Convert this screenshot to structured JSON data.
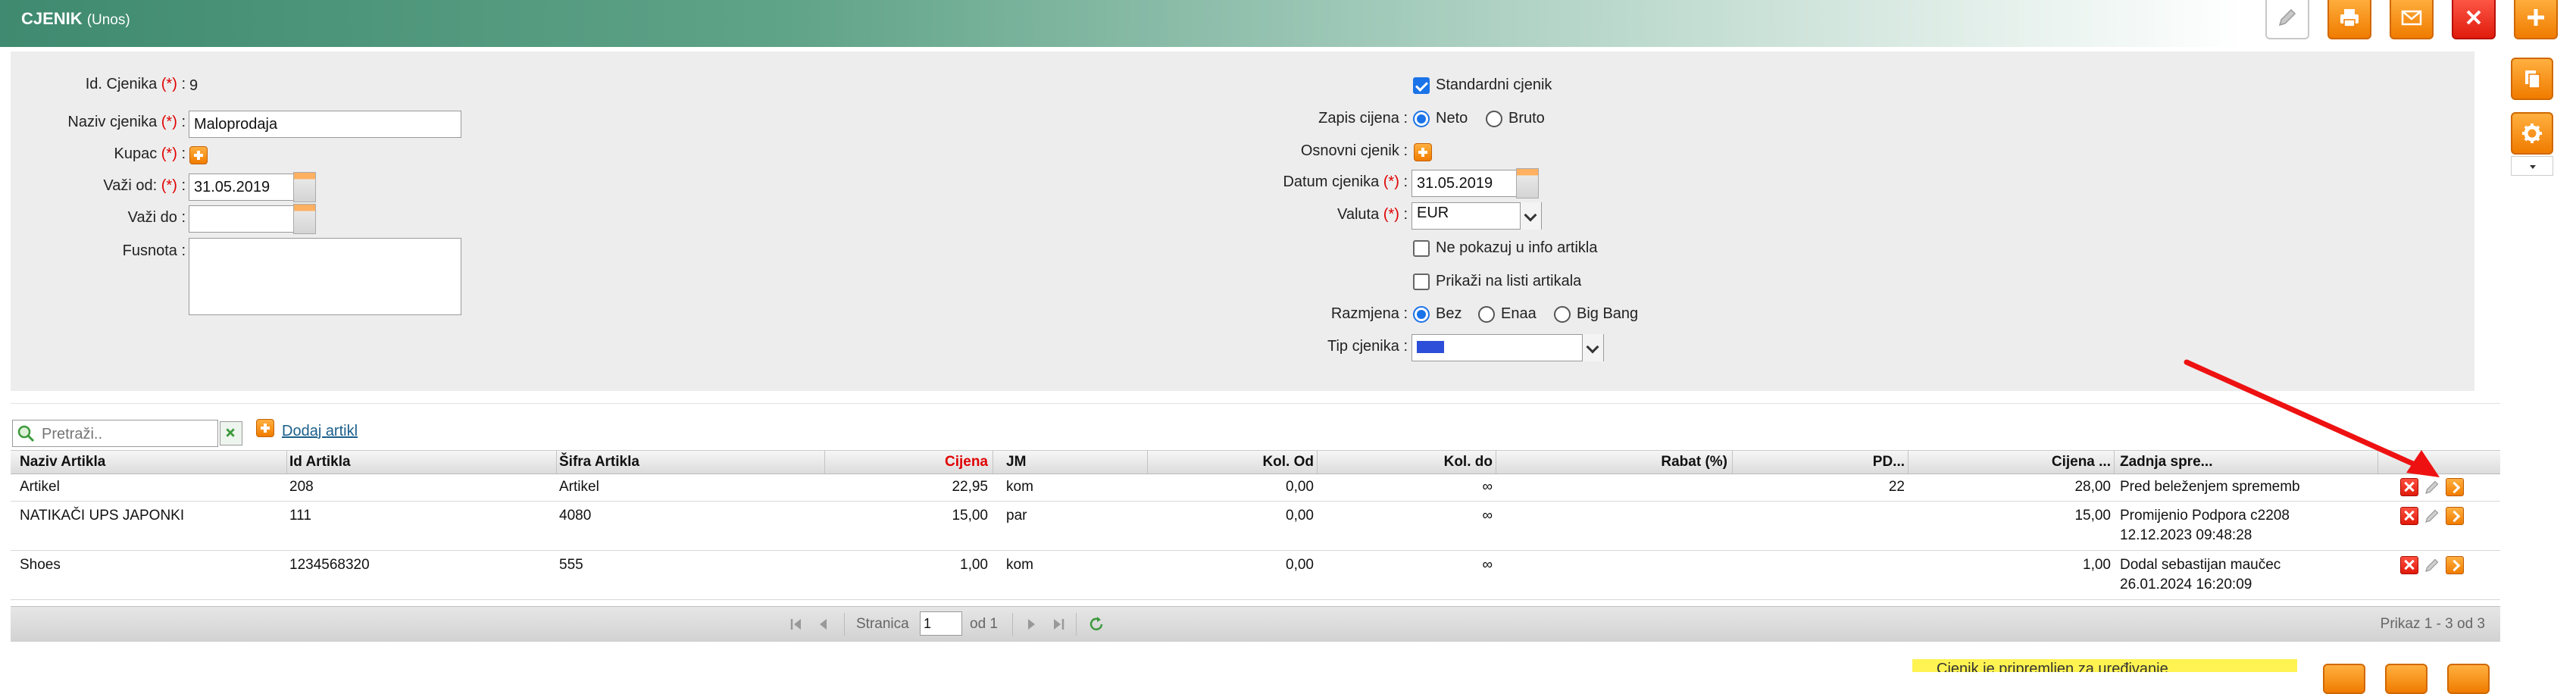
{
  "header": {
    "title": "CJENIK",
    "mode": "(Unos)",
    "toolbar_icons": [
      "pencil-icon",
      "printer-icon",
      "envelope-icon",
      "close-icon",
      "plus-icon"
    ],
    "side_icons": [
      "copy-icon",
      "gear-icon",
      "chevron-down-icon"
    ]
  },
  "form": {
    "id_label": "Id. Cjenika",
    "id_value": "9",
    "naziv_label": "Naziv cjenika",
    "naziv_value": "Maloprodaja",
    "kupac_label": "Kupac",
    "vazi_od_label": "Važi od:",
    "vazi_od_value": "31.05.2019",
    "vazi_do_label": "Važi do",
    "vazi_do_value": "",
    "fusnota_label": "Fusnota",
    "fusnota_value": "",
    "standardni_label": "Standardni cjenik",
    "standardni_checked": true,
    "zapis_label": "Zapis cijena",
    "zapis_options": [
      "Neto",
      "Bruto"
    ],
    "zapis_selected": "Neto",
    "osnovni_label": "Osnovni cjenik",
    "datum_label": "Datum cjenika",
    "datum_value": "31.05.2019",
    "valuta_label": "Valuta",
    "valuta_value": "EUR",
    "ne_pokazuj_label": "Ne pokazuj u info artikla",
    "prikazi_label": "Prikaži na listi artikala",
    "razmjena_label": "Razmjena",
    "razmjena_options": [
      "Bez",
      "Enaa",
      "Big Bang"
    ],
    "razmjena_selected": "Bez",
    "tip_label": "Tip cjenika",
    "required_mark": "(*)",
    "colon": ":"
  },
  "search": {
    "placeholder": "Pretraži..",
    "add_link": "Dodaj artikl"
  },
  "table": {
    "columns": [
      "Naziv Artikla",
      "Id Artikla",
      "Šifra Artikla",
      "Cijena",
      "JM",
      "Kol. Od",
      "Kol. do",
      "Rabat (%)",
      "PD...",
      "Cijena ...",
      "Zadnja spre..."
    ],
    "price_column_color": "#e00000",
    "rows": [
      {
        "naziv": "Artikel",
        "id": "208",
        "sifra": "Artikel",
        "cijena": "22,95",
        "jm": "kom",
        "kol_od": "0,00",
        "kol_do": "∞",
        "rabat": "",
        "pd": "22",
        "cijena2": "28,00",
        "zadnja": "Pred beleženjem sprememb",
        "zadnja2": ""
      },
      {
        "naziv": "NATIKAČI UPS JAPONKI",
        "id": "111",
        "sifra": "4080",
        "cijena": "15,00",
        "jm": "par",
        "kol_od": "0,00",
        "kol_do": "∞",
        "rabat": "",
        "pd": "",
        "cijena2": "15,00",
        "zadnja": "Promijenio Podpora c2208",
        "zadnja2": "12.12.2023 09:48:28"
      },
      {
        "naziv": "Shoes",
        "id": "1234568320",
        "sifra": "555",
        "cijena": "1,00",
        "jm": "kom",
        "kol_od": "0,00",
        "kol_do": "∞",
        "rabat": "",
        "pd": "",
        "cijena2": "1,00",
        "zadnja": "Dodal sebastijan maučec",
        "zadnja2": "26.01.2024 16:20:09"
      }
    ]
  },
  "pager": {
    "page_label": "Stranica",
    "page_value": "1",
    "of_label": "od 1",
    "summary": "Prikaz 1 - 3 od 3"
  },
  "status": {
    "message": "Cjenik je pripremljen za uređivanje"
  },
  "annotation": {
    "arrow_color": "#ee1111"
  }
}
